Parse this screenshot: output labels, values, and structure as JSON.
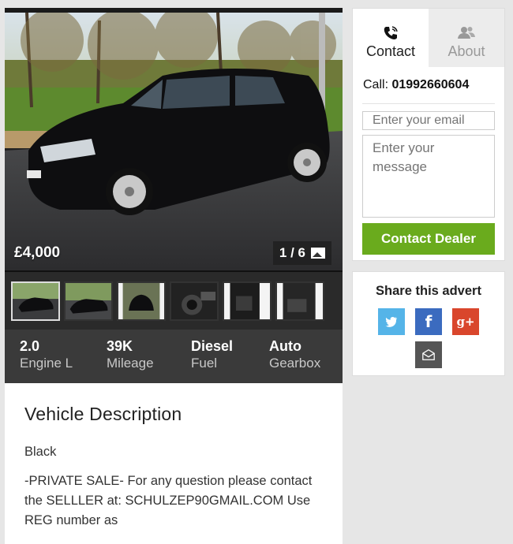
{
  "listing": {
    "price": "£4,000",
    "photo_counter": "1 / 6",
    "thumbnails": [
      "photo-1",
      "photo-2",
      "photo-3",
      "photo-4",
      "photo-5",
      "photo-6"
    ]
  },
  "specs": [
    {
      "value": "2.0",
      "label": "Engine L"
    },
    {
      "value": "39K",
      "label": "Mileage"
    },
    {
      "value": "Diesel",
      "label": "Fuel"
    },
    {
      "value": "Auto",
      "label": "Gearbox"
    }
  ],
  "description": {
    "title": "Vehicle Description",
    "color": "Black",
    "body": "-PRIVATE SALE- For any question please contact the SELLLER at: SCHULZEP90GMAIL.COM Use REG number as"
  },
  "contact": {
    "tabs": [
      {
        "label": "Contact",
        "icon": "phone-icon"
      },
      {
        "label": "About",
        "icon": "users-icon"
      }
    ],
    "call_prefix": "Call: ",
    "phone": "01992660604",
    "email_placeholder": "Enter your email",
    "message_placeholder": "Enter your message",
    "button_label": "Contact Dealer"
  },
  "share": {
    "title": "Share this advert",
    "buttons": [
      "twitter-icon",
      "facebook-icon",
      "google-plus-icon",
      "email-icon"
    ],
    "colors": {
      "twitter": "#55b4e8",
      "facebook": "#3b6bbf",
      "google_plus": "#d9462c",
      "email": "#555555"
    }
  },
  "colors": {
    "accent": "#6aab1d",
    "spec_bar": "#3a3a3a"
  }
}
